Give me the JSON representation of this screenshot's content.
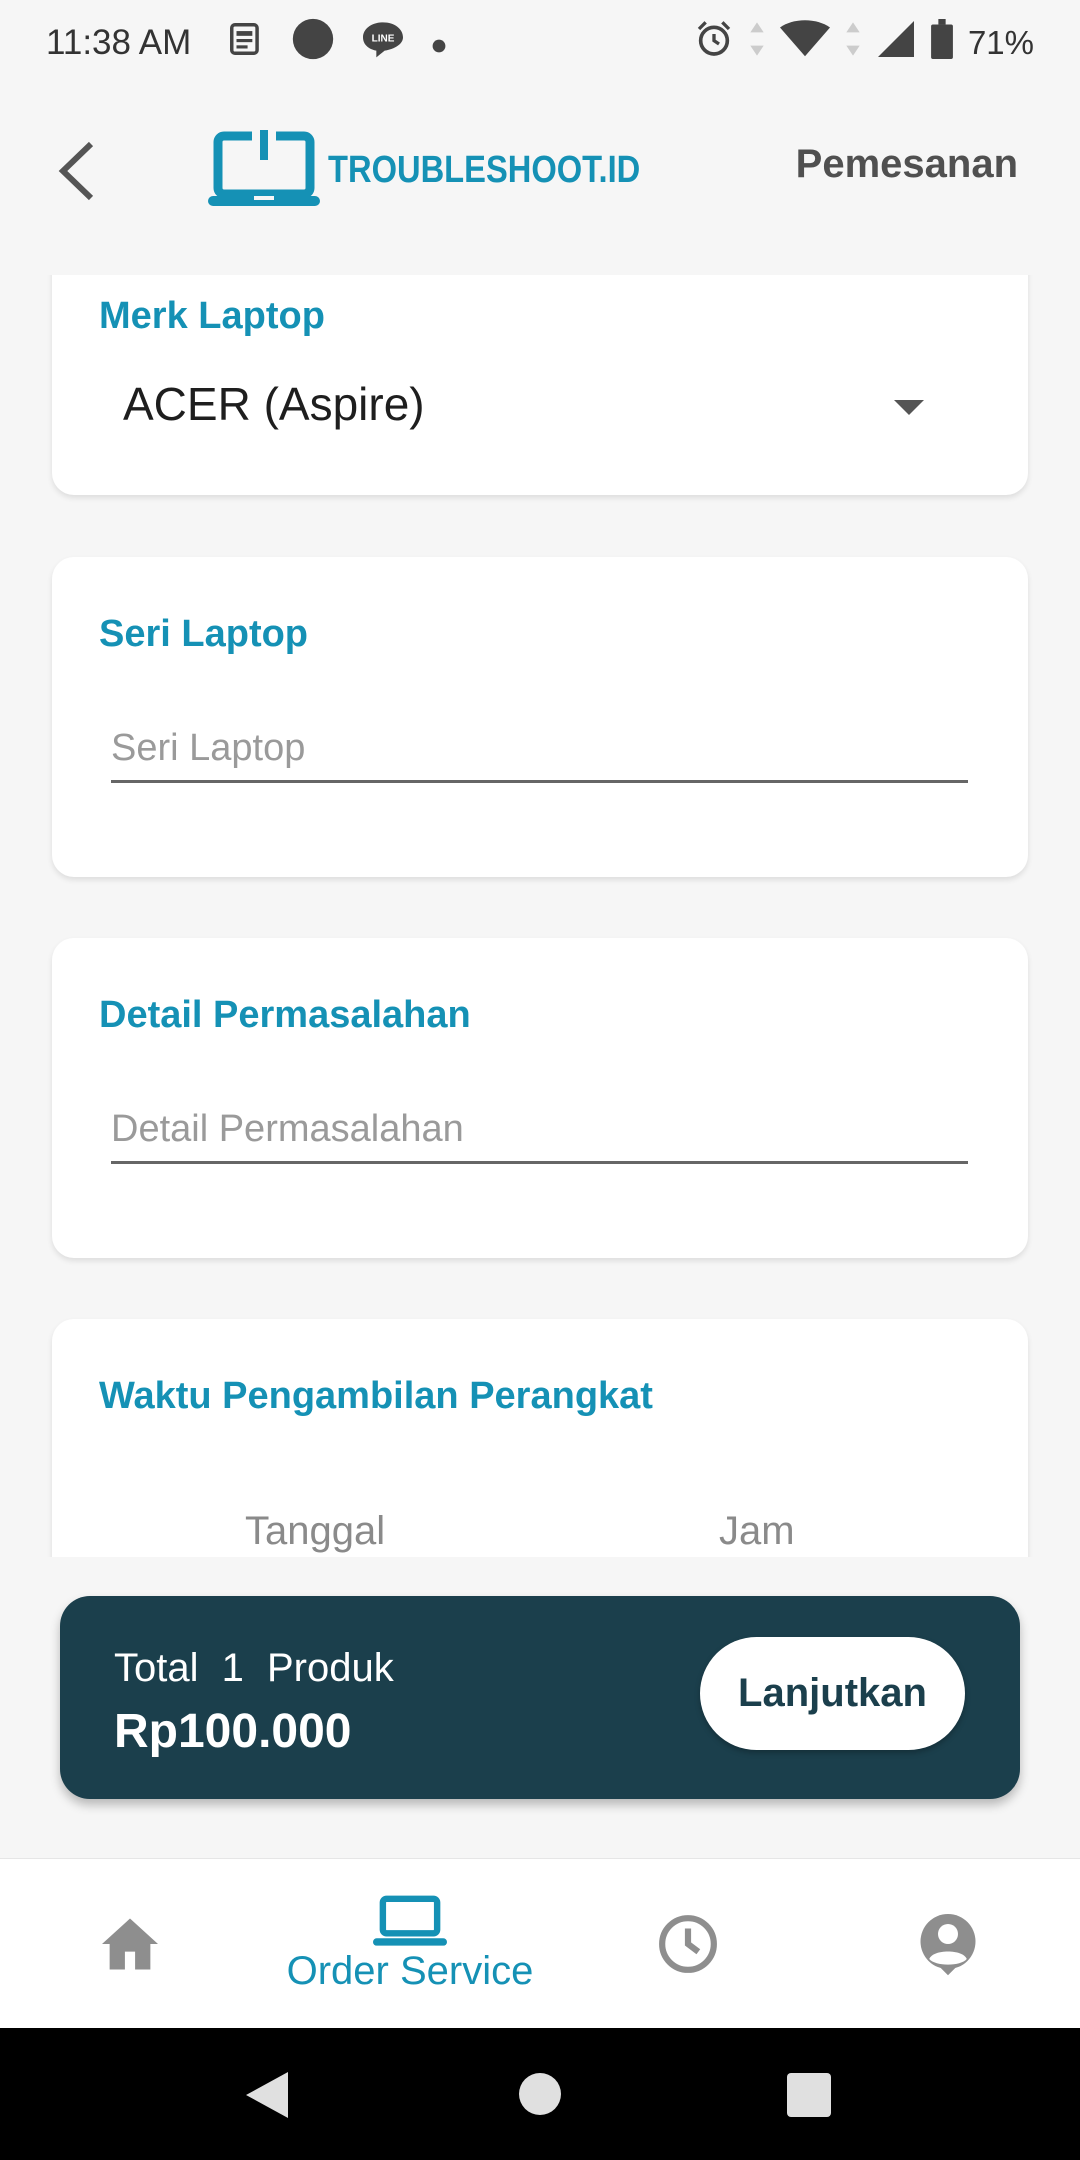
{
  "status_bar": {
    "time": "11:38 AM",
    "icons_left": [
      "news-icon",
      "circle-icon",
      "line-app-icon",
      "dot-icon"
    ],
    "icons_right": [
      "alarm-icon",
      "data-arrows-icon",
      "wifi-icon",
      "signal-icon",
      "battery-icon"
    ],
    "battery": "71%"
  },
  "header": {
    "logo_text": "TROUBLESHOOT.ID",
    "title": "Pemesanan"
  },
  "form": {
    "brand": {
      "label": "Merk Laptop",
      "value": "ACER (Aspire)"
    },
    "series": {
      "label": "Seri Laptop",
      "placeholder": "Seri Laptop"
    },
    "problem": {
      "label": "Detail Permasalahan",
      "placeholder": "Detail Permasalahan"
    },
    "pickup": {
      "label": "Waktu Pengambilan Perangkat",
      "date_label": "Tanggal",
      "time_label": "Jam"
    }
  },
  "summary": {
    "total_word": "Total",
    "count": "1",
    "unit": "Produk",
    "price": "Rp100.000",
    "continue_label": "Lanjutkan"
  },
  "bottom_nav": {
    "items": [
      {
        "icon": "home-icon",
        "label": ""
      },
      {
        "icon": "laptop-icon",
        "label": "Order Service",
        "active": true
      },
      {
        "icon": "clock-icon",
        "label": ""
      },
      {
        "icon": "profile-icon",
        "label": ""
      }
    ]
  },
  "colors": {
    "accent": "#1591b5",
    "dark_bar": "#1b3f4c",
    "inactive_icon": "#8e8e8e"
  }
}
